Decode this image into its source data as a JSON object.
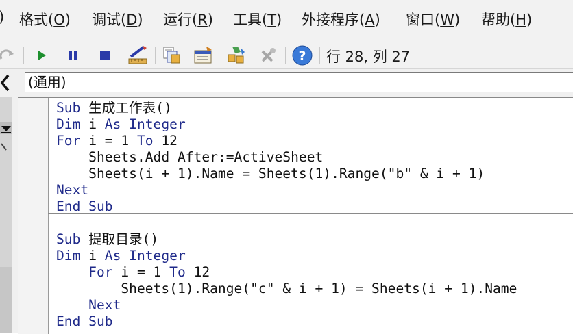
{
  "menu": [
    {
      "label": ")"
    },
    {
      "label": "格式",
      "key": "O"
    },
    {
      "label": "调试",
      "key": "D"
    },
    {
      "label": "运行",
      "key": "R"
    },
    {
      "label": "工具",
      "key": "T"
    },
    {
      "label": "外接程序",
      "key": "A"
    },
    {
      "label": "窗口",
      "key": "W"
    },
    {
      "label": "帮助",
      "key": "H"
    }
  ],
  "toolbar": {
    "position_text": "行 28, 列 27",
    "icons": [
      "redo-icon",
      "run-icon",
      "break-icon",
      "reset-icon",
      "design-mode-icon",
      "project-explorer-icon",
      "properties-window-icon",
      "object-browser-icon",
      "toolbox-icon",
      "help-icon"
    ]
  },
  "object_combo": {
    "value": "(通用)"
  },
  "code": {
    "lines": [
      [
        {
          "t": "Sub ",
          "k": 1
        },
        {
          "t": "生成工作表()",
          "k": 0
        }
      ],
      [
        {
          "t": "Dim ",
          "k": 1
        },
        {
          "t": "i ",
          "k": 0
        },
        {
          "t": "As Integer",
          "k": 1
        }
      ],
      [
        {
          "t": "For ",
          "k": 1
        },
        {
          "t": "i = 1 ",
          "k": 0
        },
        {
          "t": "To ",
          "k": 1
        },
        {
          "t": "12",
          "k": 0
        }
      ],
      [
        {
          "t": "    Sheets.Add After:=ActiveSheet",
          "k": 0
        }
      ],
      [
        {
          "t": "    Sheets(i + 1).Name = Sheets(1).Range(\"b\" & i + 1)",
          "k": 0
        }
      ],
      [
        {
          "t": "Next",
          "k": 1
        }
      ],
      [
        {
          "t": "End Sub",
          "k": 1
        }
      ],
      [
        {
          "t": "",
          "k": 0
        }
      ],
      [
        {
          "t": "Sub ",
          "k": 1
        },
        {
          "t": "提取目录()",
          "k": 0
        }
      ],
      [
        {
          "t": "Dim ",
          "k": 1
        },
        {
          "t": "i ",
          "k": 0
        },
        {
          "t": "As Integer",
          "k": 1
        }
      ],
      [
        {
          "t": "    For ",
          "k": 1
        },
        {
          "t": "i = 1 ",
          "k": 0
        },
        {
          "t": "To ",
          "k": 1
        },
        {
          "t": "12",
          "k": 0
        }
      ],
      [
        {
          "t": "        Sheets(1).Range(\"c\" & i + 1) = Sheets(i + 1).Name",
          "k": 0
        }
      ],
      [
        {
          "t": "    Next",
          "k": 1
        }
      ],
      [
        {
          "t": "End Sub",
          "k": 1
        }
      ]
    ]
  },
  "colors": {
    "keyword": "#1f2a8a",
    "text": "#111111",
    "toolbar_bg": "#f2f2f2"
  }
}
